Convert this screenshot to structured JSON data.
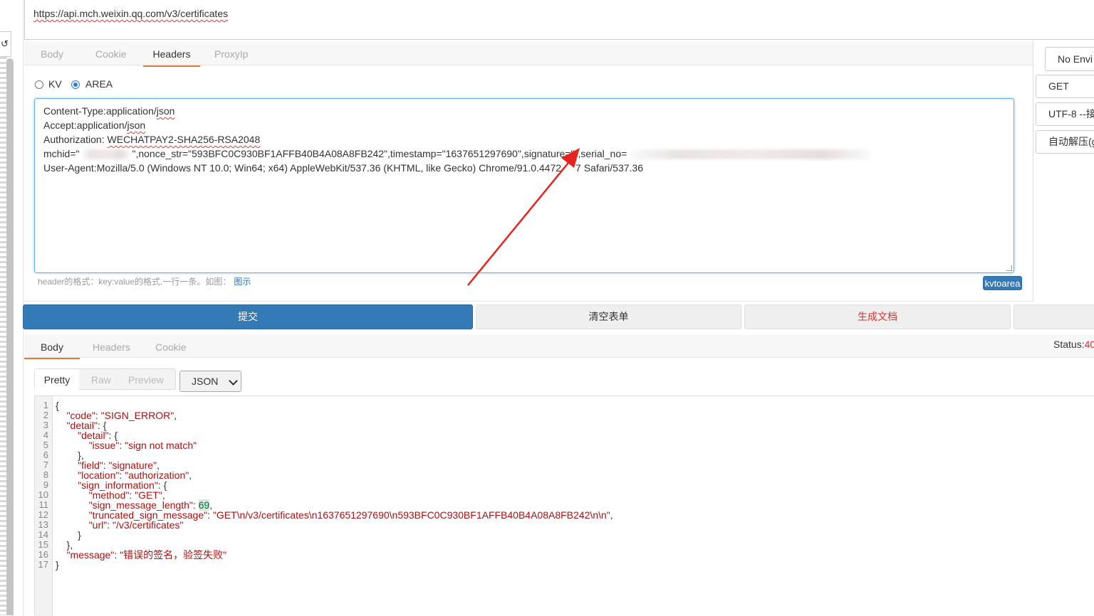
{
  "url": "https://api.mch.weixin.qq.com/v3/certificates",
  "gutter_icon": "↺",
  "request_tabs": [
    "Body",
    "Cookie",
    "Headers",
    "ProxyIp"
  ],
  "active_request_tab": "Headers",
  "header_mode": {
    "kv_label": "KV",
    "area_label": "AREA",
    "selected": "AREA"
  },
  "headers_text": {
    "line1": "Content-Type:application/json",
    "line2": "Accept:application/json",
    "line3": "Authorization: WECHATPAY2-SHA256-RSA2048",
    "line4_a": "mchid=\"",
    "line4_b": "\",nonce_str=\"593BFC0C930BF1AFFB40B4A08A8FB242\",timestamp=\"1637651297690\",signature=\"\",serial_no=",
    "line5": "User-Agent:Mozilla/5.0 (Windows NT 10.0; Win64; x64) AppleWebKit/537.36 (KHTML, like Gecko) Chrome/91.0.4472",
    "line5_tail": "7 Safari/537.36"
  },
  "hint": {
    "text": "header的格式：key:value的格式,一行一条。如图：",
    "link": "图示"
  },
  "kvtoarea_label": "kvtoarea",
  "right_panel": {
    "env_select": "No Envi",
    "method": "GET",
    "encoding": "UTF-8 --接",
    "decompress": "自动解压(g"
  },
  "actions": {
    "submit": "提交",
    "clear": "清空表单",
    "generate": "生成文档"
  },
  "response_tabs": [
    "Body",
    "Headers",
    "Cookie"
  ],
  "active_response_tab": "Body",
  "status": {
    "label": "Status:",
    "code": "40"
  },
  "view_modes": [
    "Pretty",
    "Raw",
    "Preview"
  ],
  "active_view_mode": "Pretty",
  "format_select": "JSON",
  "response_lines": [
    {
      "n": "1",
      "t": "{"
    },
    {
      "n": "2",
      "t": "    \"code\": \"SIGN_ERROR\","
    },
    {
      "n": "3",
      "t": "    \"detail\": {"
    },
    {
      "n": "4",
      "t": "        \"detail\": {"
    },
    {
      "n": "5",
      "t": "            \"issue\": \"sign not match\""
    },
    {
      "n": "6",
      "t": "        },"
    },
    {
      "n": "7",
      "t": "        \"field\": \"signature\","
    },
    {
      "n": "8",
      "t": "        \"location\": \"authorization\","
    },
    {
      "n": "9",
      "t": "        \"sign_information\": {"
    },
    {
      "n": "10",
      "t": "            \"method\": \"GET\","
    },
    {
      "n": "11",
      "t": "            \"sign_message_length\": 69,"
    },
    {
      "n": "12",
      "t": "            \"truncated_sign_message\": \"GET\\n/v3/certificates\\n1637651297690\\n593BFC0C930BF1AFFB40B4A08A8FB242\\n\\n\","
    },
    {
      "n": "13",
      "t": "            \"url\": \"/v3/certificates\""
    },
    {
      "n": "14",
      "t": "        }"
    },
    {
      "n": "15",
      "t": "    },"
    },
    {
      "n": "16",
      "t": "    \"message\": \"错误的签名，验签失败\""
    },
    {
      "n": "17",
      "t": "}"
    }
  ],
  "colors": {
    "accent": "#337ab7",
    "tab_active_underline": "#e07b39",
    "danger": "#d9322f",
    "json_string": "#a11111"
  }
}
